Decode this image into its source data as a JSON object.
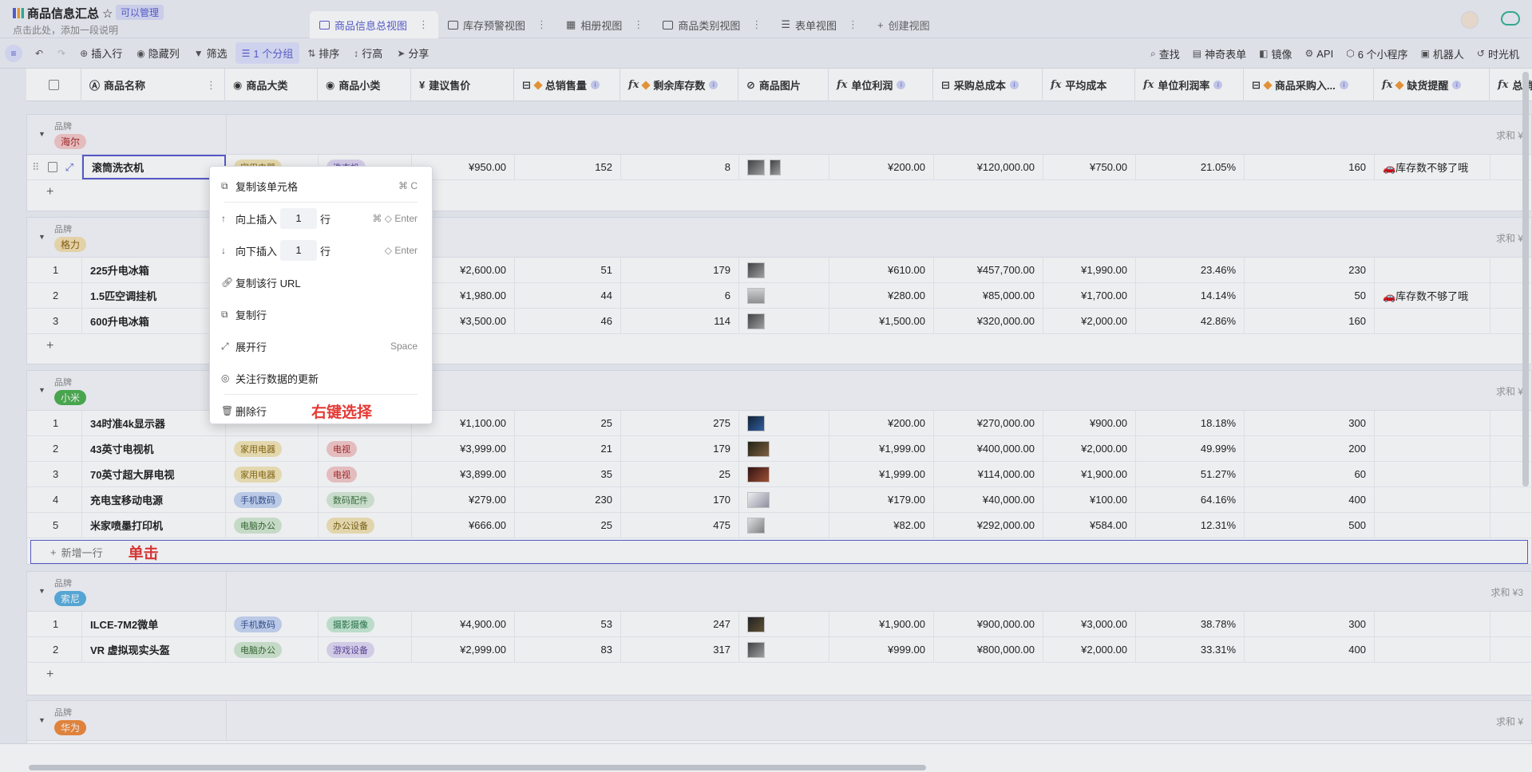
{
  "header": {
    "title": "商品信息汇总",
    "star": "☆",
    "badge": "可以管理",
    "desc": "点击此处，添加一段说明"
  },
  "tabs": [
    {
      "label": "商品信息总视图",
      "icon": "grid-icon",
      "active": true
    },
    {
      "label": "库存预警视图",
      "icon": "grid-icon"
    },
    {
      "label": "相册视图",
      "icon": "gallery-icon"
    },
    {
      "label": "商品类别视图",
      "icon": "grid-icon"
    },
    {
      "label": "表单视图",
      "icon": "form-icon"
    }
  ],
  "create_view": "创建视图",
  "toolbar": {
    "insert_row": "插入行",
    "hide_cols": "隐藏列",
    "filter": "筛选",
    "group": "1 个分组",
    "sort": "排序",
    "row_height": "行高",
    "share": "分享",
    "find": "查找",
    "magic_form": "神奇表单",
    "mirror": "镜像",
    "api": "API",
    "mini_apps": "6 个小程序",
    "robot": "机器人",
    "time_machine": "时光机"
  },
  "columns": [
    {
      "label": "商品名称",
      "icon": "text-icon"
    },
    {
      "label": "商品大类",
      "icon": "select-icon"
    },
    {
      "label": "商品小类",
      "icon": "select-icon"
    },
    {
      "label": "建议售价",
      "icon": "currency-icon"
    },
    {
      "label": "总销售量",
      "icon": "lookup-icon"
    },
    {
      "label": "剩余库存数",
      "icon": "formula-icon"
    },
    {
      "label": "商品图片",
      "icon": "attachment-icon"
    },
    {
      "label": "单位利润",
      "icon": "formula-icon"
    },
    {
      "label": "采购总成本",
      "icon": "lookup-icon"
    },
    {
      "label": "平均成本",
      "icon": "formula-icon"
    },
    {
      "label": "单位利润率",
      "icon": "formula-icon"
    },
    {
      "label": "商品采购入...",
      "icon": "lookup-icon"
    },
    {
      "label": "缺货提醒",
      "icon": "formula-icon"
    },
    {
      "label": "总销售",
      "icon": "formula-icon"
    }
  ],
  "group_label": "品牌",
  "groups": [
    {
      "brand": "海尔",
      "brand_color": "#f6c9c9",
      "brand_text": "#a82a2a",
      "sum": "求和 ¥",
      "rows": [
        {
          "idx": "",
          "name": "滚筒洗衣机",
          "cat": "家用电器",
          "sub": "洗衣机",
          "price": "¥950.00",
          "sales": "152",
          "stock": "8",
          "profit": "¥200.00",
          "cost": "¥120,000.00",
          "avg": "¥750.00",
          "rate": "21.05%",
          "buy": "160",
          "alert": "🚗库存数不够了哦"
        }
      ]
    },
    {
      "brand": "格力",
      "brand_color": "#f5e0b0",
      "brand_text": "#8a6010",
      "sum": "求和 ¥",
      "rows": [
        {
          "idx": "1",
          "name": "225升电冰箱",
          "price": "¥2,600.00",
          "sales": "51",
          "stock": "179",
          "profit": "¥610.00",
          "cost": "¥457,700.00",
          "avg": "¥1,990.00",
          "rate": "23.46%",
          "buy": "230",
          "alert": ""
        },
        {
          "idx": "2",
          "name": "1.5匹空调挂机",
          "price": "¥1,980.00",
          "sales": "44",
          "stock": "6",
          "profit": "¥280.00",
          "cost": "¥85,000.00",
          "avg": "¥1,700.00",
          "rate": "14.14%",
          "buy": "50",
          "alert": "🚗库存数不够了哦"
        },
        {
          "idx": "3",
          "name": "600升电冰箱",
          "price": "¥3,500.00",
          "sales": "46",
          "stock": "114",
          "profit": "¥1,500.00",
          "cost": "¥320,000.00",
          "avg": "¥2,000.00",
          "rate": "42.86%",
          "buy": "160",
          "alert": ""
        }
      ]
    },
    {
      "brand": "小米",
      "brand_color": "#4cb050",
      "brand_text": "#ffffff",
      "sum": "求和 ¥",
      "rows": [
        {
          "idx": "1",
          "name": "34时准4k显示器",
          "cat": "",
          "sub": "",
          "price": "¥1,100.00",
          "sales": "25",
          "stock": "275",
          "profit": "¥200.00",
          "cost": "¥270,000.00",
          "avg": "¥900.00",
          "rate": "18.18%",
          "buy": "300",
          "alert": ""
        },
        {
          "idx": "2",
          "name": "43英寸电视机",
          "cat": "家用电器",
          "sub": "电视",
          "price": "¥3,999.00",
          "sales": "21",
          "stock": "179",
          "profit": "¥1,999.00",
          "cost": "¥400,000.00",
          "avg": "¥2,000.00",
          "rate": "49.99%",
          "buy": "200",
          "alert": ""
        },
        {
          "idx": "3",
          "name": "70英寸超大屏电视",
          "cat": "家用电器",
          "sub": "电视",
          "price": "¥3,899.00",
          "sales": "35",
          "stock": "25",
          "profit": "¥1,999.00",
          "cost": "¥114,000.00",
          "avg": "¥1,900.00",
          "rate": "51.27%",
          "buy": "60",
          "alert": ""
        },
        {
          "idx": "4",
          "name": "充电宝移动电源",
          "cat": "手机数码",
          "sub": "数码配件",
          "price": "¥279.00",
          "sales": "230",
          "stock": "170",
          "profit": "¥179.00",
          "cost": "¥40,000.00",
          "avg": "¥100.00",
          "rate": "64.16%",
          "buy": "400",
          "alert": ""
        },
        {
          "idx": "5",
          "name": "米家喷墨打印机",
          "cat": "电脑办公",
          "sub": "办公设备",
          "price": "¥666.00",
          "sales": "25",
          "stock": "475",
          "profit": "¥82.00",
          "cost": "¥292,000.00",
          "avg": "¥584.00",
          "rate": "12.31%",
          "buy": "500",
          "alert": ""
        }
      ]
    },
    {
      "brand": "索尼",
      "brand_color": "#5ab0e0",
      "brand_text": "#ffffff",
      "sum": "求和 ¥3",
      "rows": [
        {
          "idx": "1",
          "name": "ILCE-7M2微单",
          "cat": "手机数码",
          "sub": "摄影摄像",
          "price": "¥4,900.00",
          "sales": "53",
          "stock": "247",
          "profit": "¥1,900.00",
          "cost": "¥900,000.00",
          "avg": "¥3,000.00",
          "rate": "38.78%",
          "buy": "300",
          "alert": ""
        },
        {
          "idx": "2",
          "name": "VR 虚拟现实头盔",
          "cat": "电脑办公",
          "sub": "游戏设备",
          "price": "¥2,999.00",
          "sales": "83",
          "stock": "317",
          "profit": "¥999.00",
          "cost": "¥800,000.00",
          "avg": "¥2,000.00",
          "rate": "33.31%",
          "buy": "400",
          "alert": ""
        }
      ]
    },
    {
      "brand": "华为",
      "brand_color": "#f08a3c",
      "brand_text": "#ffffff",
      "sum": "求和 ¥",
      "rows": []
    }
  ],
  "add_row_label": "新增一行",
  "add_row_annotation": "单击",
  "context_menu": {
    "copy_cell": "复制该单元格",
    "copy_cell_shortcut": "⌘ C",
    "insert_above": "向上插入",
    "insert_above_count": "1",
    "insert_above_unit": "行",
    "insert_above_shortcut": "⌘ ◇ Enter",
    "insert_below": "向下插入",
    "insert_below_count": "1",
    "insert_below_unit": "行",
    "insert_below_shortcut": "◇ Enter",
    "copy_url": "复制该行 URL",
    "copy_row": "复制行",
    "expand_row": "展开行",
    "expand_shortcut": "Space",
    "follow_updates": "关注行数据的更新",
    "delete_row": "删除行",
    "annotation": "右键选择"
  },
  "first_row_partial": {
    "cat": "家用电器",
    "sub": "洗衣机"
  }
}
